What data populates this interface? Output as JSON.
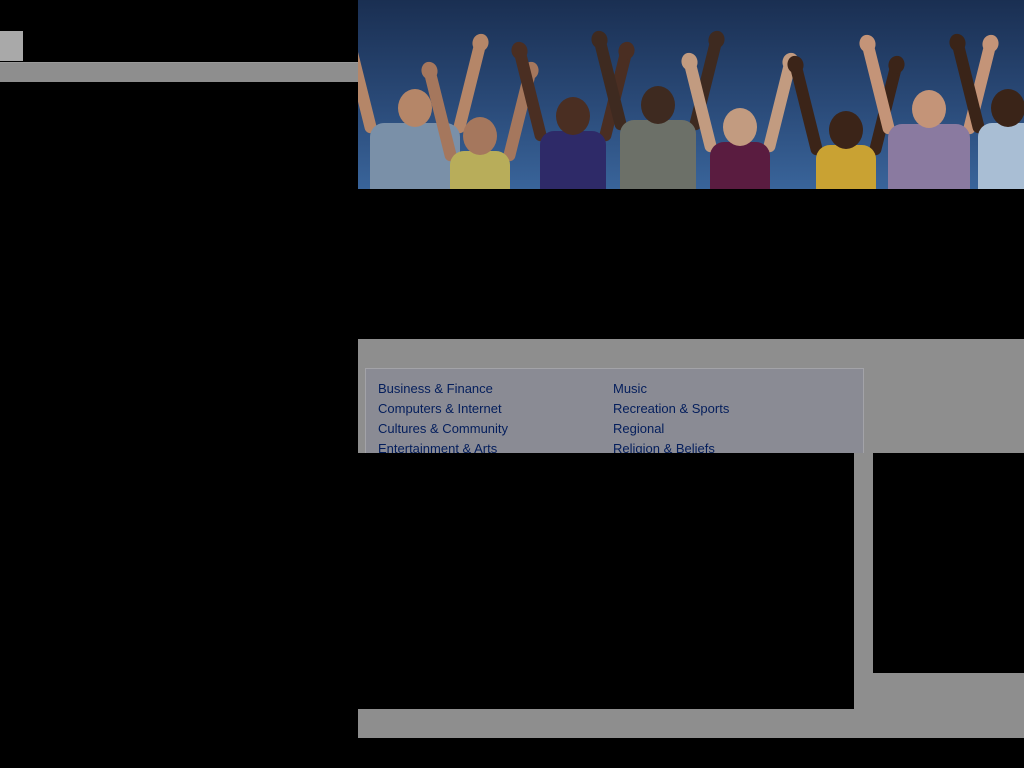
{
  "hero": {
    "people": [
      {
        "name": "person-1",
        "shirt": "#7a90a8",
        "skin": "#b58668"
      },
      {
        "name": "person-2",
        "shirt": "#b8ad5a",
        "skin": "#a5775d"
      },
      {
        "name": "person-3",
        "shirt": "#2e2a68",
        "skin": "#4a2e22"
      },
      {
        "name": "person-4",
        "shirt": "#6c7068",
        "skin": "#3e2a20"
      },
      {
        "name": "person-5",
        "shirt": "#5a1c40",
        "skin": "#c29b80"
      },
      {
        "name": "person-6",
        "shirt": "#c9a233",
        "skin": "#3b2418"
      },
      {
        "name": "person-7",
        "shirt": "#8a7aa0",
        "skin": "#c49478"
      },
      {
        "name": "person-8",
        "shirt": "#a9bed4",
        "skin": "#3a2418"
      }
    ]
  },
  "categories": {
    "left": [
      "Business & Finance",
      "Computers & Internet",
      "Cultures & Community",
      "Entertainment & Arts"
    ],
    "right": [
      "Music",
      "Recreation & Sports",
      "Regional",
      "Religion & Beliefs"
    ]
  },
  "colors": {
    "link": "#041e5c",
    "panel": "#8e8e8e",
    "overlay": "#000000"
  }
}
